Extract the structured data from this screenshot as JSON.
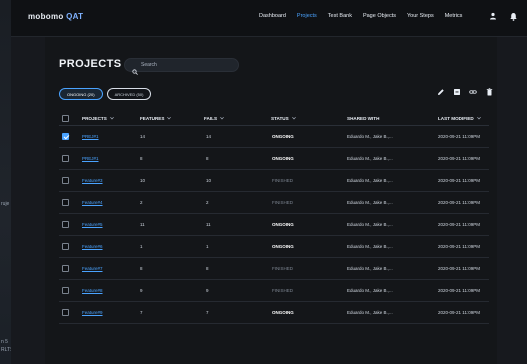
{
  "left_strip": {
    "lines": [
      "ruje",
      "n 5",
      "RLTS"
    ]
  },
  "topbar": {
    "logo_main": "mobomo ",
    "logo_accent": "QAT",
    "nav": [
      {
        "label": "Dashboard",
        "active": false
      },
      {
        "label": "Projects",
        "active": true
      },
      {
        "label": "Test Bank",
        "active": false
      },
      {
        "label": "Page Objects",
        "active": false
      },
      {
        "label": "Your Steps",
        "active": false
      },
      {
        "label": "Metrics",
        "active": false
      }
    ],
    "icons": [
      "user-icon",
      "bell-icon"
    ]
  },
  "page": {
    "title": "PROJECTS",
    "search_placeholder": "Search",
    "toggles": [
      {
        "label": "ONGOING (20)",
        "active": true
      },
      {
        "label": "ARCHIVED (50)",
        "active": false
      }
    ],
    "toolbar_icons": [
      "edit-icon",
      "archive-icon",
      "link-icon",
      "trash-icon"
    ]
  },
  "table": {
    "headers": {
      "projects": "PROJECTS",
      "features": "FEATURES",
      "fails": "FAILS",
      "status": "STATUS",
      "shared_with": "SHARED WITH",
      "last_modified": "LAST MODIFIED"
    },
    "rows": [
      {
        "checked": true,
        "project": "PREJ#1",
        "features": "14",
        "fails": "14",
        "status": "ONGOING",
        "status_type": "ongoing",
        "shared": "Eduardo M., Jake B.,...",
        "modified": "2020-09-21 11:09PM"
      },
      {
        "checked": false,
        "project": "PREJ#1",
        "features": "8",
        "fails": "8",
        "status": "ONGOING",
        "status_type": "ongoing",
        "shared": "Eduardo M., Jake B.,...",
        "modified": "2020-09-21 11:09PM"
      },
      {
        "checked": false,
        "project": "Feature#3",
        "features": "10",
        "fails": "10",
        "status": "FINISHED",
        "status_type": "finished",
        "shared": "Eduardo M., Jake B.,...",
        "modified": "2020-09-21 11:09PM"
      },
      {
        "checked": false,
        "project": "Feature#4",
        "features": "2",
        "fails": "2",
        "status": "FINISHED",
        "status_type": "finished",
        "shared": "Eduardo M., Jake B.,...",
        "modified": "2020-09-21 11:09PM"
      },
      {
        "checked": false,
        "project": "Feature#5",
        "features": "11",
        "fails": "11",
        "status": "ONGOING",
        "status_type": "ongoing",
        "shared": "Eduardo M., Jake B.,...",
        "modified": "2020-09-21 11:09PM"
      },
      {
        "checked": false,
        "project": "Feature#6",
        "features": "1",
        "fails": "1",
        "status": "ONGOING",
        "status_type": "ongoing",
        "shared": "Eduardo M., Jake B.,...",
        "modified": "2020-09-21 11:09PM"
      },
      {
        "checked": false,
        "project": "Feature#7",
        "features": "8",
        "fails": "8",
        "status": "FINISHED",
        "status_type": "finished",
        "shared": "Eduardo M., Jake B.,...",
        "modified": "2020-09-21 11:09PM"
      },
      {
        "checked": false,
        "project": "Feature#8",
        "features": "9",
        "fails": "9",
        "status": "FINISHED",
        "status_type": "finished",
        "shared": "Eduardo M., Jake B.,...",
        "modified": "2020-09-21 11:09PM"
      },
      {
        "checked": false,
        "project": "Feature#9",
        "features": "7",
        "fails": "7",
        "status": "ONGOING",
        "status_type": "ongoing",
        "shared": "Eduardo M., Jake B.,...",
        "modified": "2020-09-21 11:09PM"
      }
    ]
  }
}
